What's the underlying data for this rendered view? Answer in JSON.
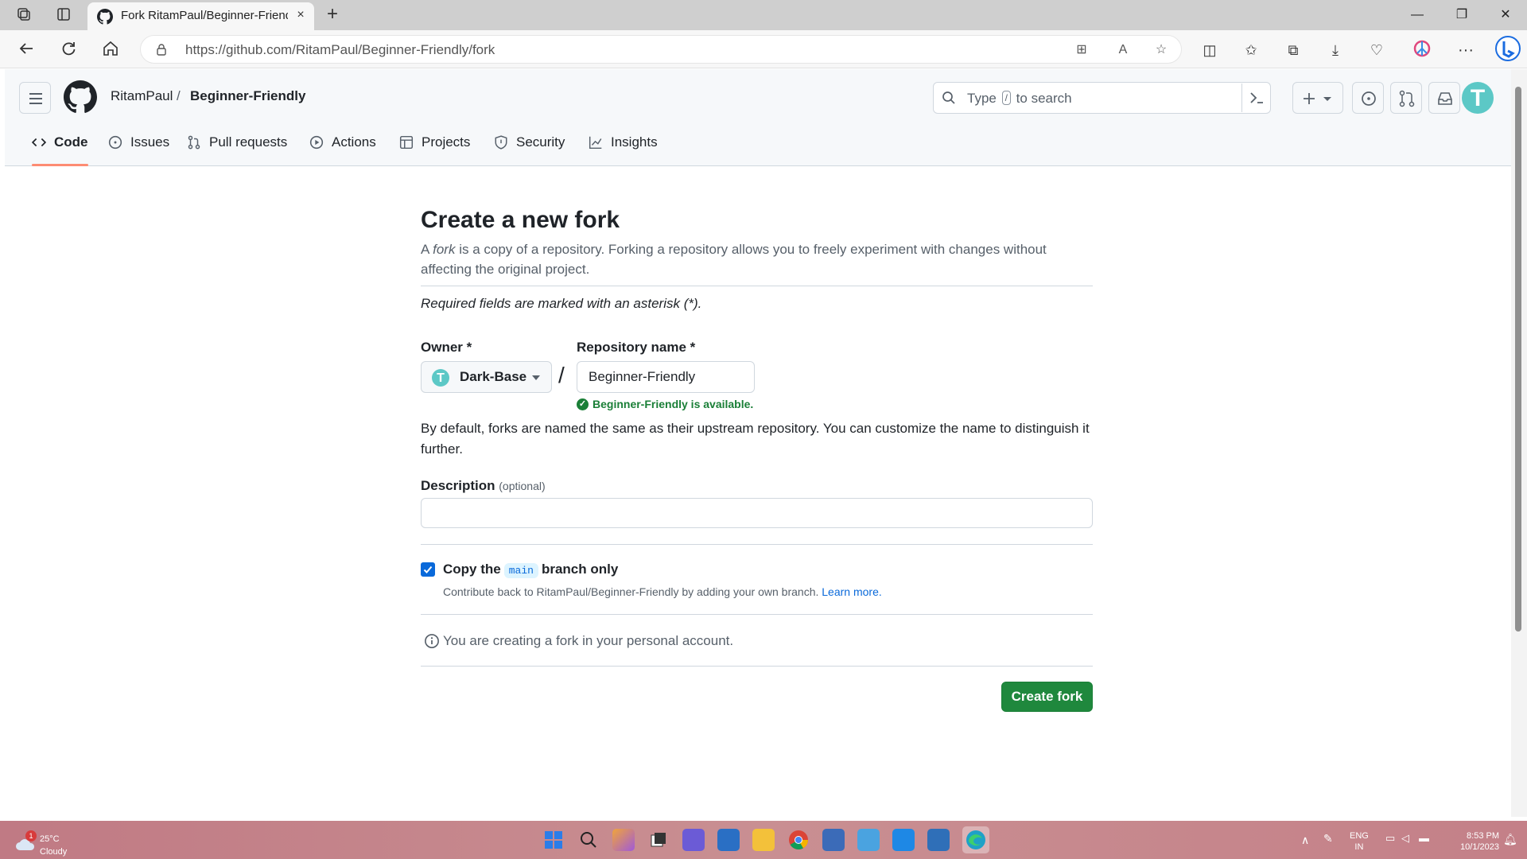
{
  "browser": {
    "tab_title": "Fork RitamPaul/Beginner-Friendly",
    "url": "https://github.com/RitamPaul/Beginner-Friendly/fork",
    "new_tab_glyph": "+",
    "close_glyph": "×"
  },
  "header": {
    "owner": "RitamPaul",
    "separator": "/",
    "repo": "Beginner-Friendly",
    "search_prefix": "Type",
    "search_key": "/",
    "search_suffix": "to search",
    "avatar_letter": "T"
  },
  "repo_nav": [
    {
      "label": "Code",
      "icon": "code-icon",
      "active": true
    },
    {
      "label": "Issues",
      "icon": "issue-icon"
    },
    {
      "label": "Pull requests",
      "icon": "pull-request-icon"
    },
    {
      "label": "Actions",
      "icon": "play-icon"
    },
    {
      "label": "Projects",
      "icon": "table-icon"
    },
    {
      "label": "Security",
      "icon": "shield-icon"
    },
    {
      "label": "Insights",
      "icon": "graph-icon"
    }
  ],
  "form": {
    "title": "Create a new fork",
    "intro_a": "A ",
    "intro_em": "fork",
    "intro_b": " is a copy of a repository. Forking a repository allows you to freely experiment with changes without affecting the original project.",
    "required_note": "Required fields are marked with an asterisk (*).",
    "owner_label": "Owner *",
    "owner_value": "Dark-Base",
    "owner_avatar_letter": "T",
    "repo_label": "Repository name *",
    "repo_value": "Beginner-Friendly",
    "availability": "Beginner-Friendly is available.",
    "default_note": "By default, forks are named the same as their upstream repository. You can customize the name to distinguish it further.",
    "description_label": "Description",
    "description_optional": "(optional)",
    "description_value": "",
    "copy_pre": "Copy the",
    "copy_branch": "main",
    "copy_post": "branch only",
    "copy_checked": true,
    "contrib_text": "Contribute back to RitamPaul/Beginner-Friendly by adding your own branch.",
    "learn_more": "Learn more.",
    "personal_note": "You are creating a fork in your personal account.",
    "create_button": "Create fork"
  },
  "taskbar": {
    "weather_temp": "25°C",
    "weather_cond": "Cloudy",
    "notification_count": "1",
    "lang_1": "ENG",
    "lang_2": "IN",
    "time": "8:53 PM",
    "date": "10/1/2023"
  },
  "colors": {
    "primary_button": "#1f883d",
    "accent_underline": "#fd8c73",
    "link": "#0969da",
    "success": "#1a7f37"
  }
}
